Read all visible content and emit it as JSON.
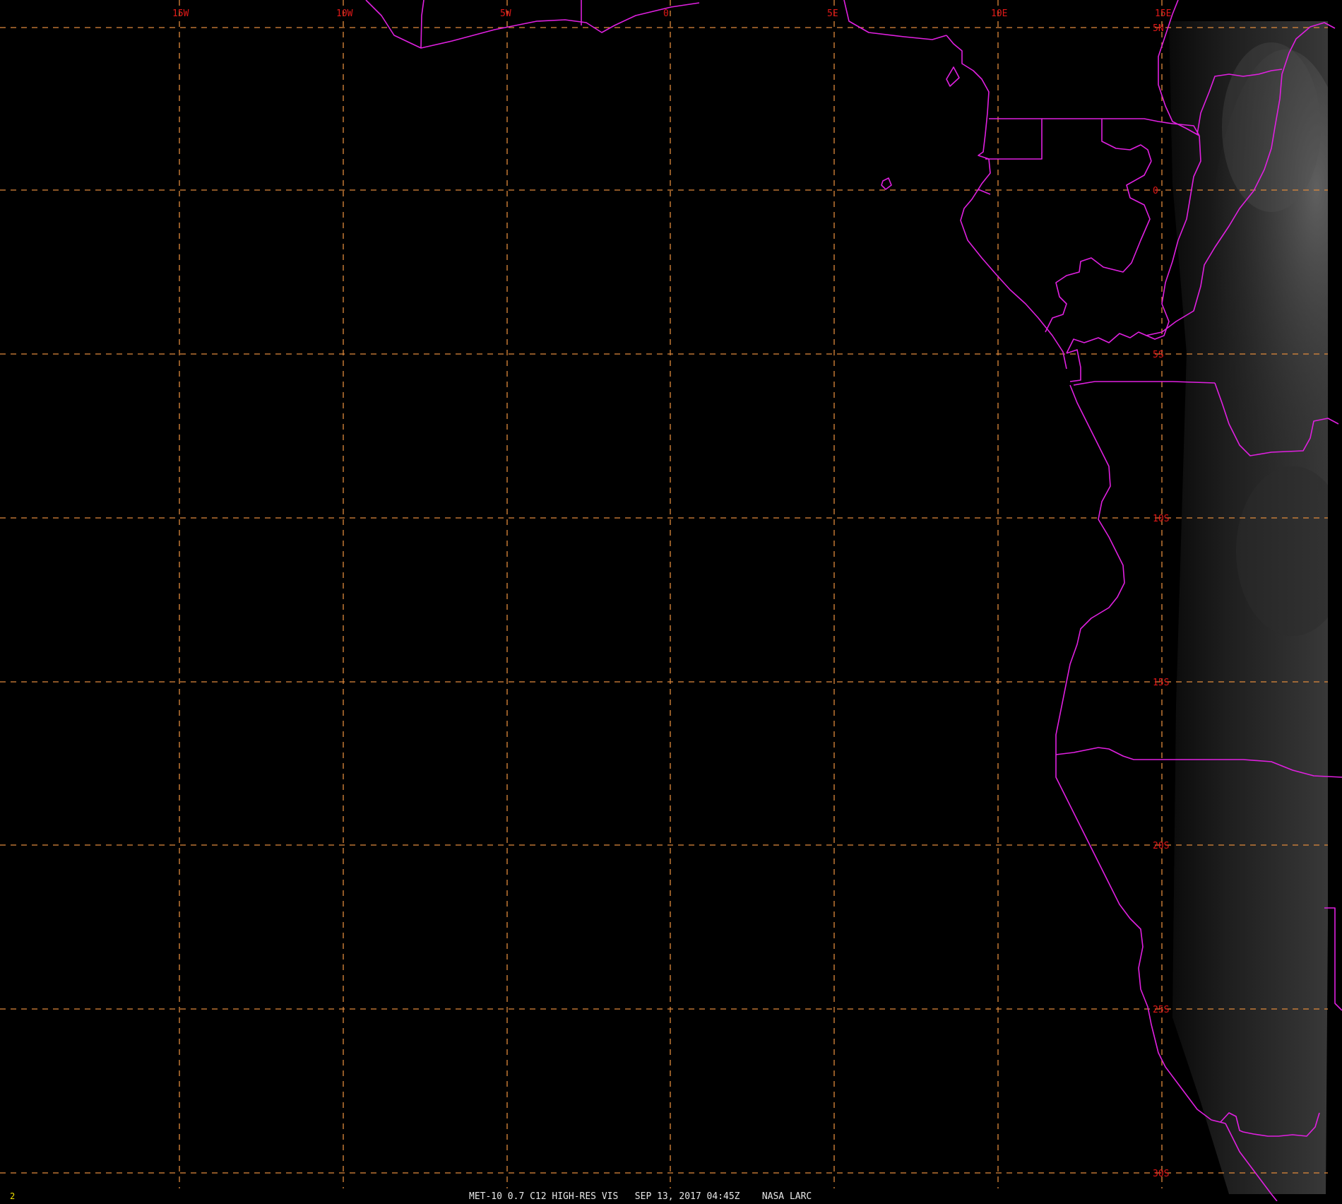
{
  "map": {
    "longitude_labels": [
      "15W",
      "10W",
      "5W",
      "0",
      "5E",
      "10E",
      "15E"
    ],
    "latitude_labels": [
      "5N",
      "0",
      "5S",
      "10S",
      "15S",
      "20S",
      "25S",
      "30S"
    ],
    "colors": {
      "grid": "#e08a3c",
      "label": "#e01818",
      "boundary": "#e020e0",
      "background": "#000000"
    }
  },
  "footer": {
    "caption": "MET-10 0.7 C12 HIGH-RES VIS   SEP 13, 2017 04:45Z    NASA LARC",
    "frame_number": "2"
  }
}
